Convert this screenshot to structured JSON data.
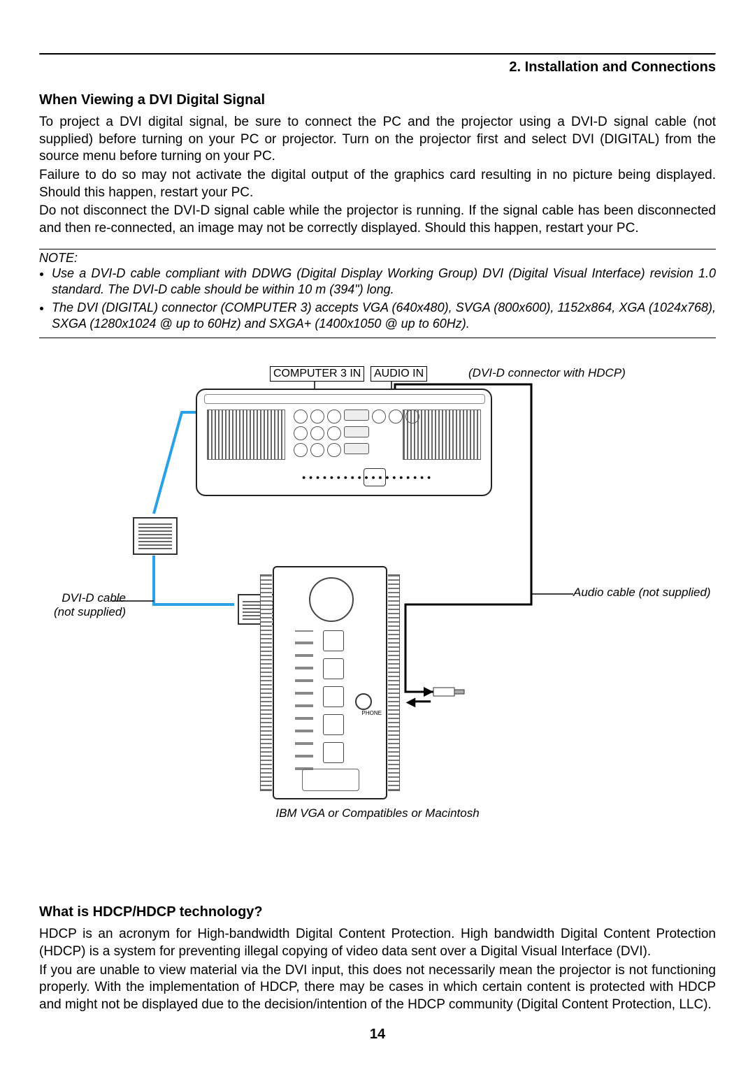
{
  "header": {
    "title": "2. Installation and Connections"
  },
  "section1": {
    "heading": "When Viewing a DVI Digital Signal",
    "p1": "To project a DVI digital signal, be sure to connect the PC and the projector using a DVI-D signal cable (not supplied) before turning on your PC or projector. Turn on the projector first and select DVI (DIGITAL) from the source menu before turning on your PC.",
    "p2": "Failure to do so may not activate the digital output of the graphics card resulting in no picture being displayed. Should this happen, restart your PC.",
    "p3": "Do not disconnect the DVI-D signal cable while the projector is running. If the signal cable has been disconnected and then re-connected, an image may not be correctly displayed. Should this happen, restart your PC."
  },
  "note": {
    "label": "NOTE:",
    "items": [
      "Use a DVI-D cable compliant with DDWG (Digital Display Working Group) DVI (Digital Visual Interface) revision 1.0 standard. The DVI-D cable should be within 10 m (394\") long.",
      "The DVI (DIGITAL) connector (COMPUTER 3) accepts VGA (640x480), SVGA (800x600), 1152x864, XGA (1024x768), SXGA (1280x1024 @ up to 60Hz) and SXGA+ (1400x1050 @ up to 60Hz)."
    ]
  },
  "diagram": {
    "computer3in": "COMPUTER 3 IN",
    "audioin": "AUDIO IN",
    "dvidconn": "(DVI-D connector with HDCP)",
    "audiocable": "Audio cable (not supplied)",
    "dvidcable1": "DVI-D cable",
    "dvidcable2": "(not supplied)",
    "phone": "PHONE",
    "caption": "IBM VGA or Compatibles or Macintosh"
  },
  "section2": {
    "heading": "What is HDCP/HDCP technology?",
    "p1": "HDCP is an acronym for High-bandwidth Digital Content Protection. High bandwidth Digital Content Protection (HDCP) is a system for preventing illegal copying of video data sent over a Digital Visual Interface (DVI).",
    "p2": "If you are unable to view material via the DVI input, this does not necessarily mean the projector is not functioning properly. With the implementation of HDCP, there may be cases in which certain content is protected with HDCP and might not be displayed due to the decision/intention of the HDCP community (Digital Content Protection, LLC)."
  },
  "pagenum": "14"
}
